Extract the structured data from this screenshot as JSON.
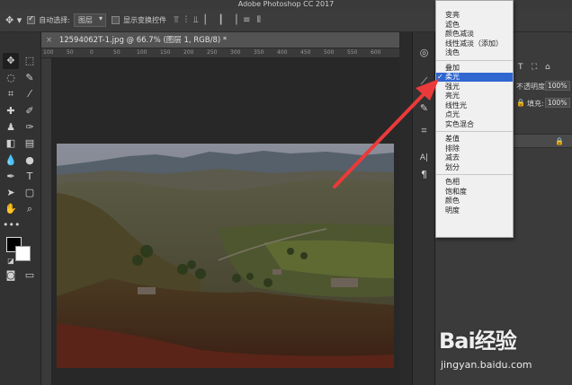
{
  "window": {
    "title": "Adobe Photoshop CC 2017"
  },
  "options_bar": {
    "auto_select_label": "自动选择:",
    "auto_select_checked": true,
    "auto_select_value": "图层",
    "show_transform_label": "显示变换控件",
    "show_transform_checked": false
  },
  "document_tab": {
    "title": "12594062T-1.jpg @ 66.7% (图层 1, RGB/8) *",
    "close": "×"
  },
  "ruler": {
    "ticks": [
      "100",
      "50",
      "0",
      "50",
      "100",
      "150",
      "200",
      "250",
      "300",
      "350",
      "400",
      "450",
      "500",
      "550",
      "600"
    ]
  },
  "layers_panel": {
    "opacity_label": "不透明度:",
    "opacity_value": "100%",
    "fill_label": "填充:",
    "fill_value": "100%"
  },
  "blend_menu": {
    "groups": [
      [
        "变亮",
        "滤色",
        "颜色减淡",
        "线性减淡（添加）",
        "浅色"
      ],
      [
        "叠加",
        "柔光",
        "强光",
        "亮光",
        "线性光",
        "点光",
        "实色混合"
      ],
      [
        "差值",
        "排除",
        "减去",
        "划分"
      ],
      [
        "色相",
        "饱和度",
        "颜色",
        "明度"
      ]
    ],
    "selected": "柔光",
    "check_mark": "✓"
  },
  "icons": {
    "move_tool": "move-icon",
    "marquee_tool": "marquee-icon",
    "lasso_tool": "lasso-icon",
    "crop_tool": "crop-icon",
    "type_tool": "type-icon",
    "zoom_tool": "zoom-icon"
  },
  "colors": {
    "foreground": "#000000",
    "background": "#ffffff",
    "menu_highlight": "#2f66d0",
    "arrow": "#ea3a3a"
  },
  "watermark": {
    "logo_text": "Bai经验",
    "url": "jingyan.baidu.com"
  }
}
